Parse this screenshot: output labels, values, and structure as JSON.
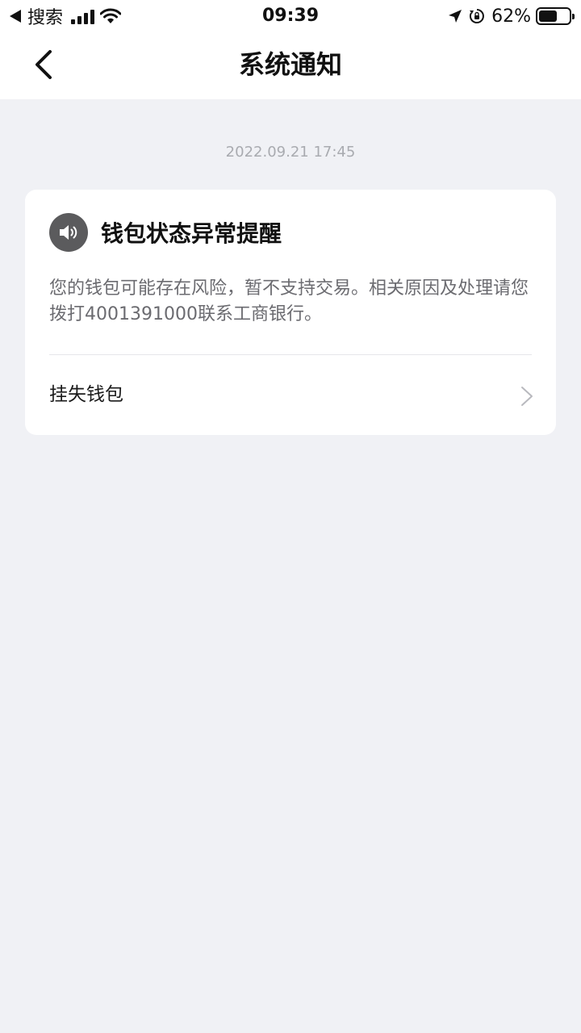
{
  "status_bar": {
    "back_app": "搜索",
    "time": "09:39",
    "battery_percent": "62%",
    "battery_level": 0.62
  },
  "nav": {
    "title": "系统通知"
  },
  "notification": {
    "timestamp": "2022.09.21 17:45",
    "title": "钱包状态异常提醒",
    "body": "您的钱包可能存在风险，暂不支持交易。相关原因及处理请您拨打4001391000联系工商银行。",
    "action_label": "挂失钱包"
  }
}
